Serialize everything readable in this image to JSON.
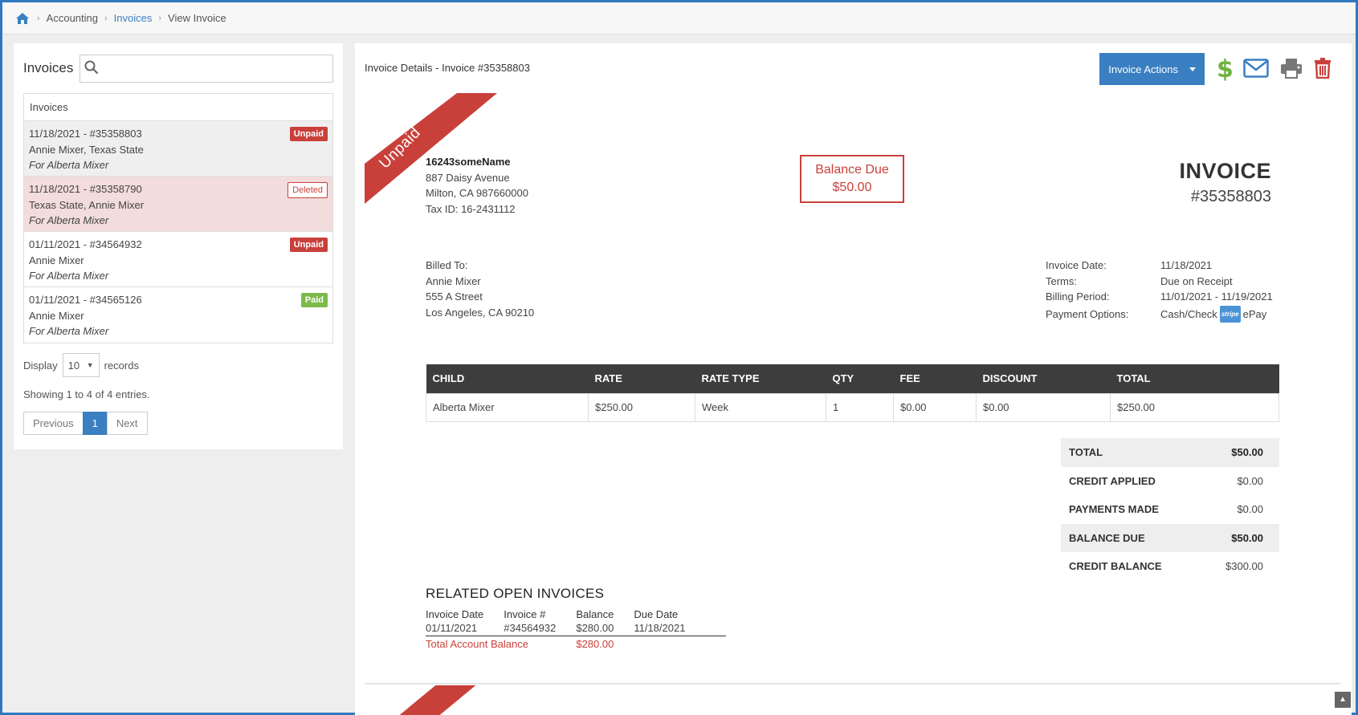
{
  "breadcrumb": {
    "home_icon": "home-icon",
    "items": [
      "Accounting",
      "Invoices",
      "View Invoice"
    ]
  },
  "sidebar": {
    "title": "Invoices",
    "search_placeholder": "",
    "list_header": "Invoices",
    "invoices": [
      {
        "line1": "11/18/2021 - #35358803",
        "line2": "Annie Mixer, Texas State",
        "line3": "For Alberta Mixer",
        "status": "Unpaid"
      },
      {
        "line1": "11/18/2021 - #35358790",
        "line2": "Texas State, Annie Mixer",
        "line3": "For Alberta Mixer",
        "status": "Deleted"
      },
      {
        "line1": "01/11/2021 - #34564932",
        "line2": "Annie Mixer",
        "line3": "For Alberta Mixer",
        "status": "Unpaid"
      },
      {
        "line1": "01/11/2021 - #34565126",
        "line2": "Annie Mixer",
        "line3": "For Alberta Mixer",
        "status": "Paid"
      }
    ],
    "display_label": "Display",
    "display_value": "10",
    "records_label": "records",
    "showing": "Showing 1 to 4 of 4 entries.",
    "pager": {
      "prev": "Previous",
      "page": "1",
      "next": "Next"
    }
  },
  "invoice": {
    "details_title": "Invoice Details - Invoice #35358803",
    "actions_label": "Invoice Actions",
    "ribbon": "Unpaid",
    "from": {
      "name": "16243someName",
      "address1": "887 Daisy Avenue",
      "address2": "Milton, CA 987660000",
      "tax_id": "Tax ID: 16-2431112"
    },
    "balance_due_label": "Balance Due",
    "balance_due_value": "$50.00",
    "title": "INVOICE",
    "number": "#35358803",
    "billed": {
      "label": "Billed To:",
      "name": "Annie Mixer",
      "address1": "555 A Street",
      "address2": "Los Angeles, CA 90210"
    },
    "meta": {
      "date_label": "Invoice Date:",
      "date": "11/18/2021",
      "terms_label": "Terms:",
      "terms": "Due on Receipt",
      "period_label": "Billing Period:",
      "period": "11/01/2021 - 11/19/2021",
      "payment_label": "Payment Options:",
      "payment_cash": "Cash/Check",
      "stripe_logo": "stripe",
      "payment_epay": "ePay"
    },
    "table": {
      "headers": [
        "CHILD",
        "RATE",
        "RATE TYPE",
        "QTY",
        "FEE",
        "DISCOUNT",
        "TOTAL"
      ],
      "rows": [
        [
          "Alberta Mixer",
          "$250.00",
          "Week",
          "1",
          "$0.00",
          "$0.00",
          "$250.00"
        ]
      ]
    },
    "totals": [
      {
        "label": "TOTAL",
        "value": "$50.00"
      },
      {
        "label": "CREDIT APPLIED",
        "value": "$0.00"
      },
      {
        "label": "PAYMENTS MADE",
        "value": "$0.00"
      },
      {
        "label": "BALANCE DUE",
        "value": "$50.00"
      },
      {
        "label": "CREDIT BALANCE",
        "value": "$300.00"
      }
    ],
    "related": {
      "title": "RELATED OPEN INVOICES",
      "headers": [
        "Invoice Date",
        "Invoice #",
        "Balance",
        "Due Date"
      ],
      "rows": [
        [
          "01/11/2021",
          "#34564932",
          "$280.00",
          "11/18/2021"
        ]
      ],
      "total_label": "Total Account Balance",
      "total_value": "$280.00"
    }
  },
  "colors": {
    "accent": "#3a7fc1",
    "danger": "#c9403a",
    "success": "#7cba49",
    "dollar": "#6cb33f"
  }
}
